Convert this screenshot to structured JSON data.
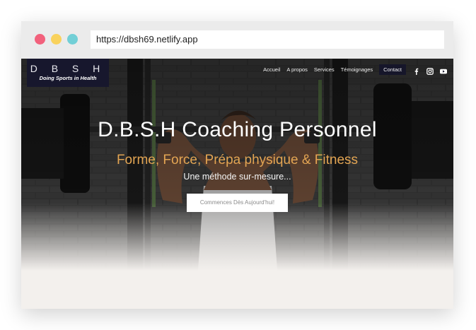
{
  "browser": {
    "url": "https://dbsh69.netlify.app",
    "traffic_lights": [
      "close-dot",
      "minimize-dot",
      "maximize-dot"
    ]
  },
  "logo": {
    "letters": "D B S H",
    "tagline": "Doing Sports in Health"
  },
  "nav": {
    "items": [
      "Accueil",
      "A propos",
      "Services",
      "Témoignages"
    ],
    "contact": "Contact",
    "social_icons": [
      "facebook-icon",
      "instagram-icon",
      "youtube-icon"
    ]
  },
  "hero": {
    "title": "D.B.S.H Coaching Personnel",
    "subtitle": "Forme, Force, Prépa physique & Fitness",
    "tagline": "Une méthode sur-mesure...",
    "cta": "Commences Dès Aujourd'hui!"
  },
  "colors": {
    "accent": "#e3a553",
    "nav_dark": "#16162a",
    "page_bg": "#f3f0ed"
  }
}
